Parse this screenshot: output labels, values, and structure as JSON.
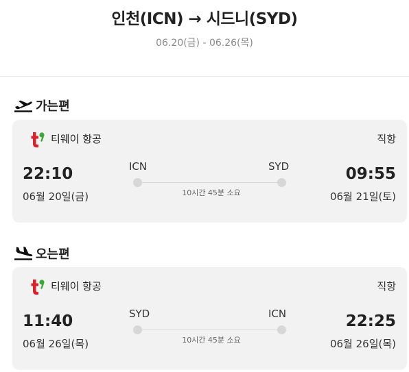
{
  "header": {
    "route_title": "인천(ICN) → 시드니(SYD)",
    "date_range": "06.20(금) - 06.26(목)"
  },
  "outbound": {
    "section_label": "가는편",
    "icon": "plane-takeoff-icon",
    "airline_logo": "tway-logo",
    "airline": "티웨이 항공",
    "direct": "직항",
    "dep_time": "22:10",
    "dep_date": "06월 20일(금)",
    "dep_code": "ICN",
    "arr_code": "SYD",
    "arr_time": "09:55",
    "arr_date": "06월 21일(토)",
    "duration": "10시간 45분 소요"
  },
  "inbound": {
    "section_label": "오는편",
    "icon": "plane-landing-icon",
    "airline_logo": "tway-logo",
    "airline": "티웨이 항공",
    "direct": "직항",
    "dep_time": "11:40",
    "dep_date": "06월 26일(목)",
    "dep_code": "SYD",
    "arr_code": "ICN",
    "arr_time": "22:25",
    "arr_date": "06월 26일(목)",
    "duration": "10시간 45분 소요"
  },
  "colors": {
    "card_bg": "#f2f2f2",
    "logo_red": "#d8232a",
    "logo_green": "#3aa935",
    "route_gray": "#d7d7d7"
  }
}
